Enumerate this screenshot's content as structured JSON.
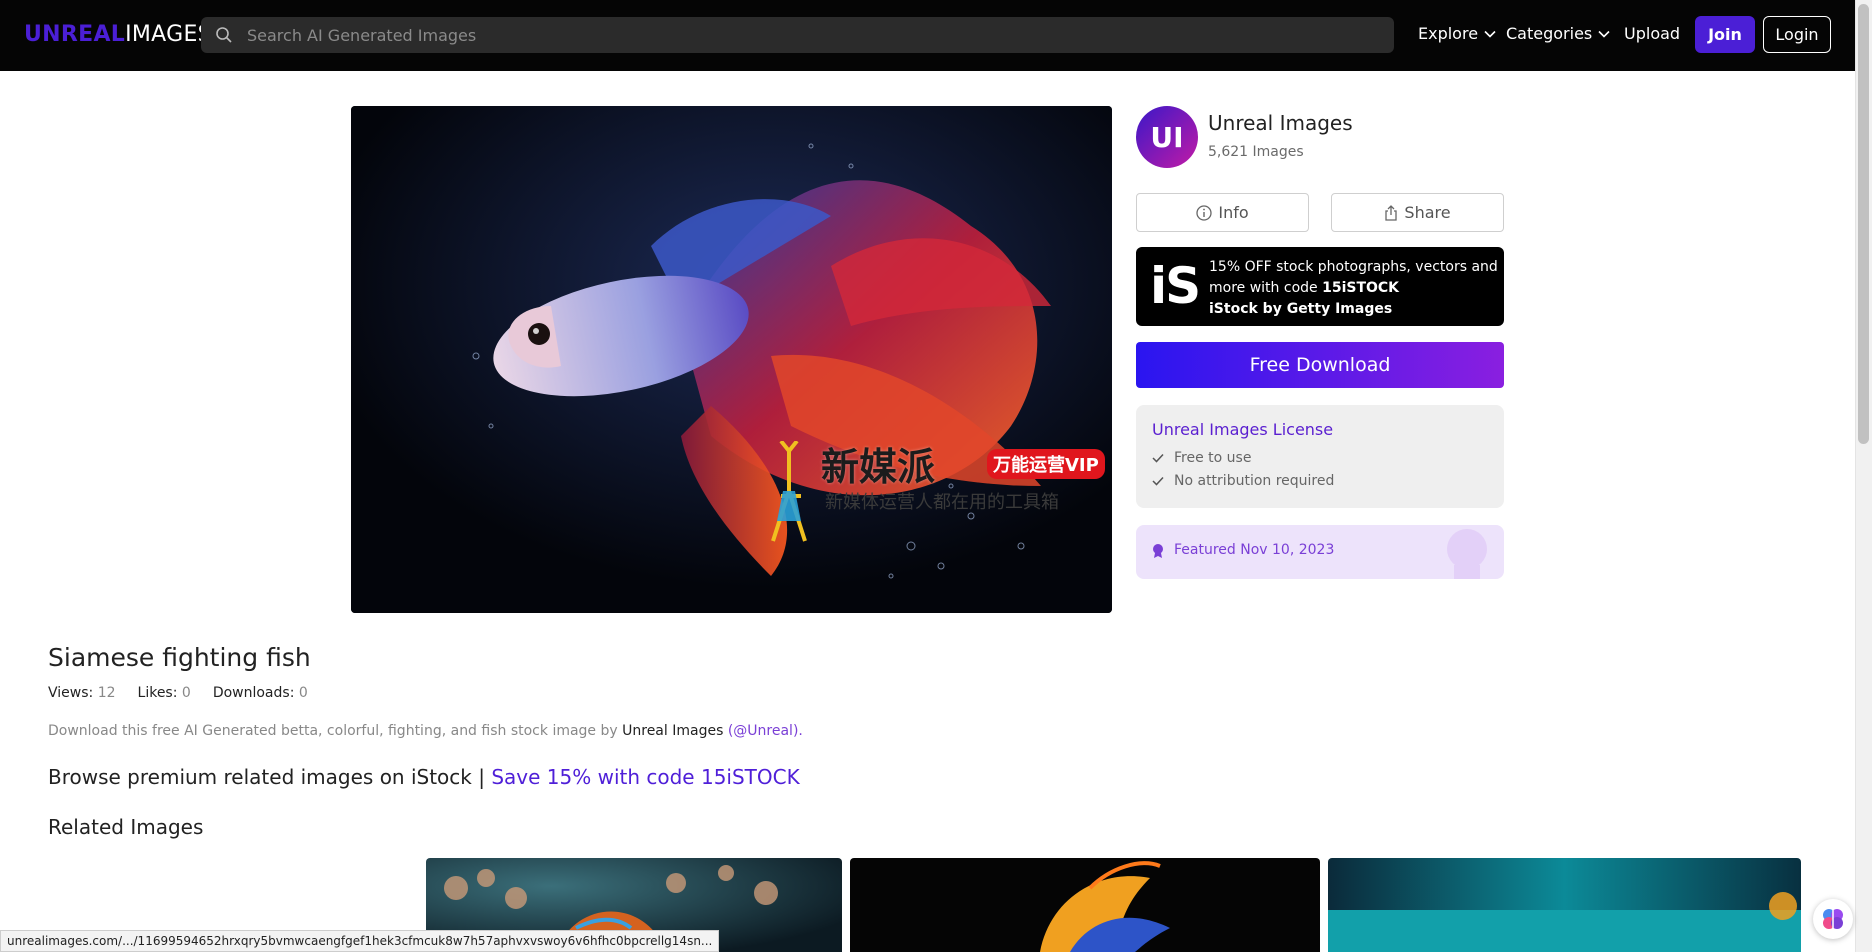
{
  "header": {
    "logo_accent": "UNREAL",
    "logo_rest": "IMAGES",
    "search_placeholder": "Search AI Generated Images",
    "nav": {
      "explore": "Explore",
      "categories": "Categories",
      "upload": "Upload"
    },
    "join_label": "Join",
    "login_label": "Login"
  },
  "image": {
    "watermark_title": "新媒派",
    "watermark_badge": "万能运营VIP",
    "watermark_sub": "新媒体运营人都在用的工具箱"
  },
  "creator": {
    "initials": "UI",
    "name": "Unreal Images",
    "count": "5,621 Images"
  },
  "actions": {
    "info_label": "Info",
    "share_label": "Share",
    "download_label": "Free Download"
  },
  "istock": {
    "logo": "iS",
    "line1": "15% OFF stock photographs, vectors and more with code",
    "code": "15iSTOCK",
    "brand": "iStock by Getty Images"
  },
  "license": {
    "title": "Unreal Images License",
    "items": [
      "Free to use",
      "No attribution required"
    ]
  },
  "featured": {
    "text": "Featured Nov 10, 2023"
  },
  "content": {
    "title": "Siamese fighting fish",
    "views_label": "Views:",
    "views_value": "12",
    "likes_label": "Likes:",
    "likes_value": "0",
    "downloads_label": "Downloads:",
    "downloads_value": "0",
    "desc_prefix": "Download this free AI Generated betta, colorful, fighting, and fish stock image by",
    "desc_author": "Unreal Images",
    "desc_handle": "(@Unreal).",
    "browse_text": "Browse premium related images on iStock |",
    "browse_promo": "Save 15% with code 15iSTOCK",
    "related_heading": "Related Images"
  },
  "status_url": "unrealimages.com/.../11699594652hrxqry5bvmwcaengfgef1hek3cfmcuk8w7h57aphvxvswoy6v6hfhc0bpcrellg14sn...",
  "colors": {
    "brand_purple": "#4b1fd6",
    "accent_violet": "#7a3fd6",
    "header_bg": "#050505"
  }
}
